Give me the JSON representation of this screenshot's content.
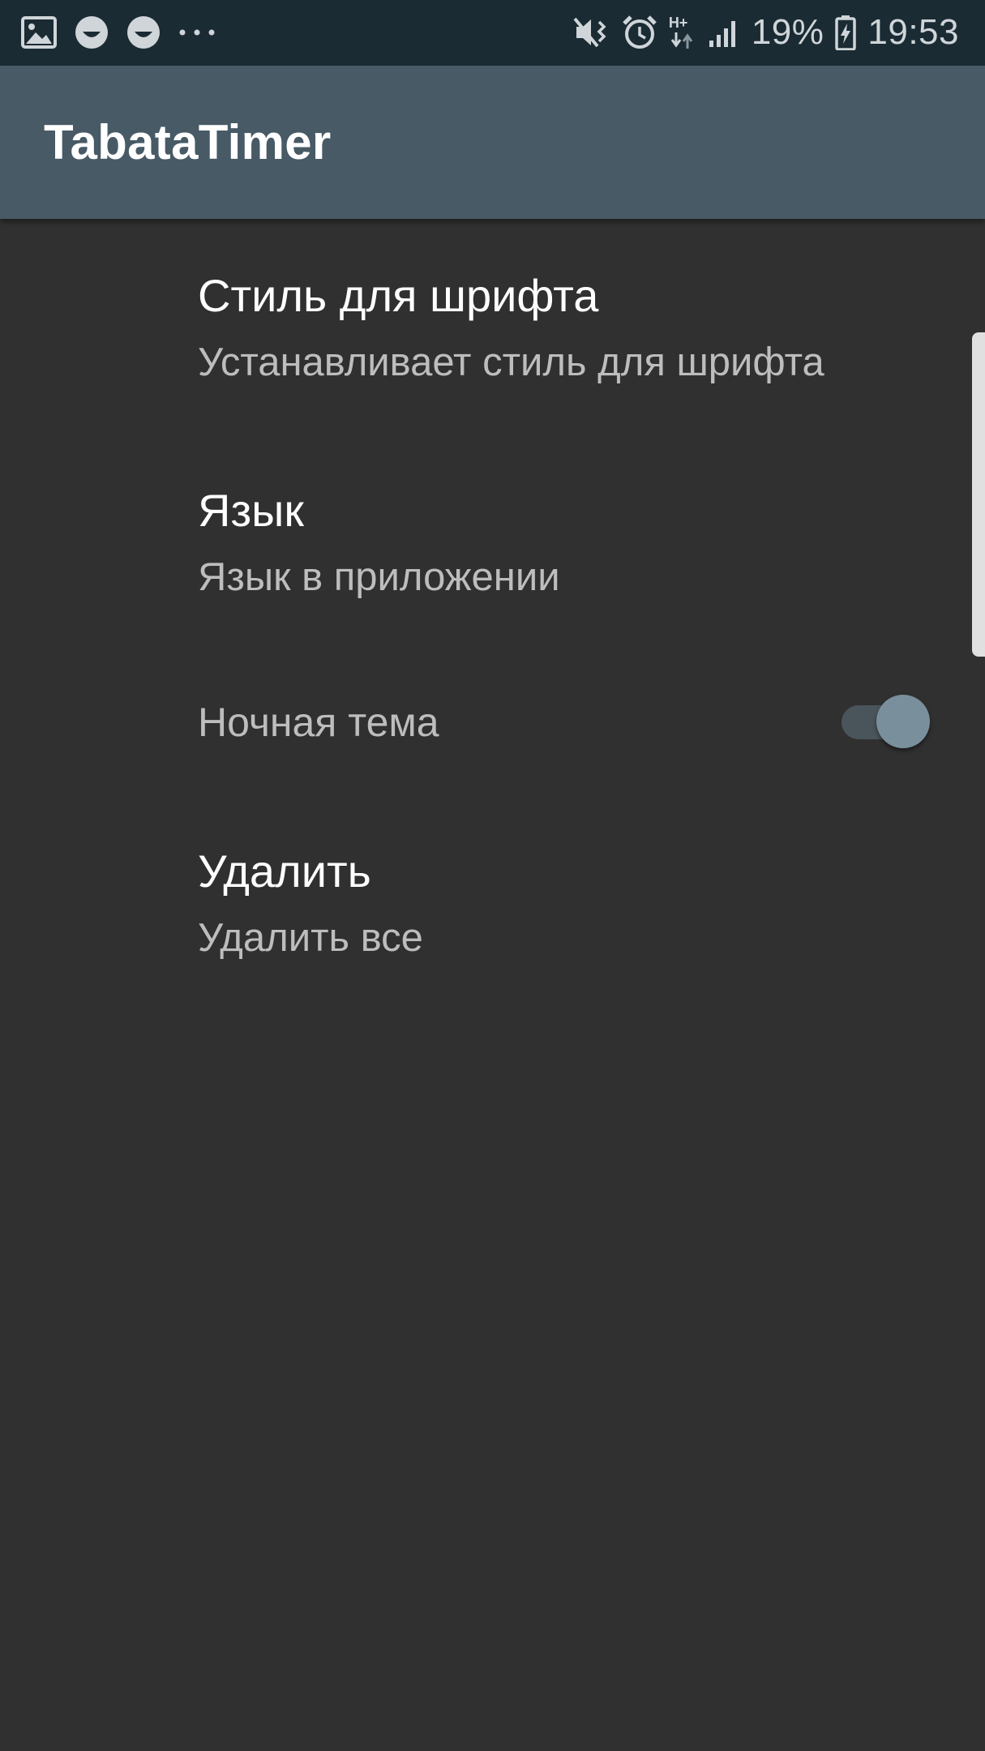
{
  "status_bar": {
    "icons_left": [
      "image-icon",
      "smiley-icon",
      "smiley-icon",
      "more-dots-icon"
    ],
    "icons_right": [
      "mute-vibrate-icon",
      "alarm-icon",
      "network-hplus-icon",
      "signal-icon"
    ],
    "network_label": "H+",
    "battery_percent": "19%",
    "time": "19:53"
  },
  "app_bar": {
    "title": "TabataTimer"
  },
  "settings": {
    "font_style": {
      "title": "Стиль для шрифта",
      "summary": "Устанавливает стиль для шрифта"
    },
    "language": {
      "title": "Язык",
      "summary": "Язык в приложении"
    },
    "night_theme": {
      "title": "Ночная тема",
      "enabled": true
    },
    "delete": {
      "title": "Удалить",
      "summary": "Удалить все"
    }
  },
  "colors": {
    "status_bar": "#1b2b34",
    "app_bar": "#475a66",
    "background": "#303030",
    "switch_thumb": "#7a8f9c"
  }
}
